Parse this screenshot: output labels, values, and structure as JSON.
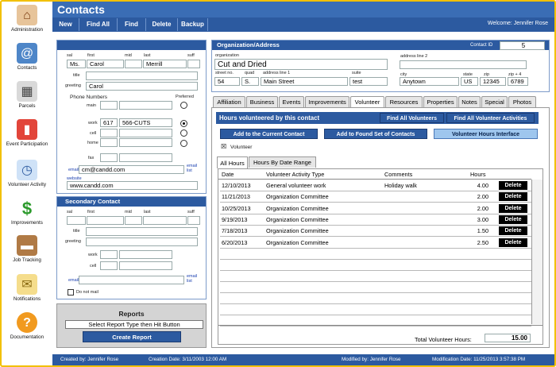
{
  "sidebar": {
    "items": [
      {
        "label": "Administration",
        "icon": "house-icon"
      },
      {
        "label": "Contacts",
        "icon": "address-book-icon"
      },
      {
        "label": "Parcels",
        "icon": "parcel-icon"
      },
      {
        "label": "Event Participation",
        "icon": "event-books-icon"
      },
      {
        "label": "Volunteer Activity",
        "icon": "clock-icon"
      },
      {
        "label": "Improvements",
        "icon": "dollar-icon"
      },
      {
        "label": "Job Tracking",
        "icon": "briefcase-icon"
      },
      {
        "label": "Notifications",
        "icon": "envelope-icon"
      },
      {
        "label": "Documentation",
        "icon": "help-icon"
      }
    ]
  },
  "header": {
    "title": "Contacts",
    "welcome": "Welcome: Jennifer Rose"
  },
  "toolbar": {
    "new": "New",
    "find_all": "Find All",
    "find": "Find",
    "delete": "Delete",
    "backup": "Backup"
  },
  "primary": {
    "title": "",
    "labels": {
      "sal": "sal",
      "first": "first",
      "mid": "mid",
      "last": "last",
      "suff": "suff",
      "title": "title",
      "greeting": "greeting",
      "phone_numbers": "Phone Numbers",
      "preferred": "Preferred",
      "main": "main",
      "work": "work",
      "cell": "cell",
      "home": "home",
      "fax": "fax",
      "email": "email",
      "website": "website",
      "email_list": "email list"
    },
    "sal": "Ms.",
    "first": "Carol",
    "mid": "",
    "last": "Merrill",
    "suff": "",
    "greeting": "Carol",
    "work_area": "617",
    "work_number": "566-CUTS",
    "email": "cm@candd.com",
    "website": "www.candd.com"
  },
  "secondary": {
    "title": "Secondary Contact",
    "labels": {
      "sal": "sal",
      "first": "first",
      "mid": "mid",
      "last": "last",
      "suff": "suff",
      "title": "title",
      "greeting": "greeting",
      "work": "work",
      "cell": "cell",
      "email": "email",
      "email_list": "email list",
      "do_not_mail": "Do not mail"
    }
  },
  "reports": {
    "title": "Reports",
    "select": "Select Report Type then Hit Button",
    "create": "Create Report"
  },
  "org": {
    "title": "Organization/Address",
    "contact_id_label": "Contact ID",
    "contact_id": "5",
    "labels": {
      "organization": "organization",
      "address_line_2": "address line 2",
      "street_no": "street no.",
      "quad": "quad",
      "address_line_1": "address line 1",
      "suite": "suite",
      "city": "city",
      "state": "state",
      "zip": "zip",
      "zip4": "zip + 4"
    },
    "organization": "Cut and Dried",
    "street_no": "54",
    "quad": "S.",
    "address_line_1": "Main Street",
    "suite": "test",
    "city": "Anytown",
    "state": "US",
    "zip": "12345",
    "zip4": "6789"
  },
  "tabs": [
    "Affiliation",
    "Business",
    "Events",
    "Improvements",
    "Volunteer",
    "Resources",
    "Properties",
    "Notes",
    "Special",
    "Photos"
  ],
  "volunteer": {
    "header": "Hours volunteered by this contact",
    "find_all_volunteers": "Find All Volunteers",
    "find_all_activities": "Find All Volunteer Activities",
    "add_current": "Add to the Current Contact",
    "add_found": "Add to Found Set of Contacts",
    "hours_interface": "Volunteer Hours Interface",
    "checkbox_label": "Volunteer",
    "subtabs": [
      "All Hours",
      "Hours By Date Range"
    ],
    "columns": {
      "date": "Date",
      "activity": "Volunteer Activity Type",
      "comments": "Comments",
      "hours": "Hours"
    },
    "delete_label": "Delete",
    "rows": [
      {
        "date": "12/10/2013",
        "activity": "General volunteer work",
        "comments": "Holiday walk",
        "hours": "4.00"
      },
      {
        "date": "11/21/2013",
        "activity": "Organization Committee",
        "comments": "",
        "hours": "2.00"
      },
      {
        "date": "10/25/2013",
        "activity": "Organization Committee",
        "comments": "",
        "hours": "2.00"
      },
      {
        "date": "9/19/2013",
        "activity": "Organization Committee",
        "comments": "",
        "hours": "3.00"
      },
      {
        "date": "7/18/2013",
        "activity": "Organization Committee",
        "comments": "",
        "hours": "1.50"
      },
      {
        "date": "6/20/2013",
        "activity": "Organization Committee",
        "comments": "",
        "hours": "2.50"
      }
    ],
    "total_label": "Total Volunteer Hours:",
    "total": "15.00"
  },
  "footer": {
    "created_by": "Created by: Jennifer Rose",
    "creation_date": "Creation Date: 3/11/2003 12:00 AM",
    "modified_by": "Modified by: Jennifer Rose",
    "modification_date": "Modification Date: 11/25/2013 3:57:38 PM"
  }
}
